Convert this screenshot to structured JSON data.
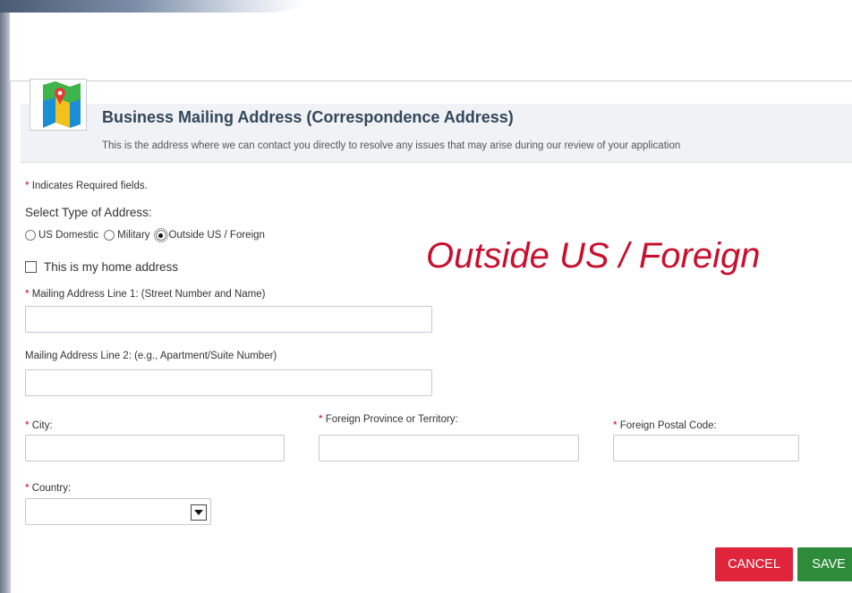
{
  "header": {
    "title": "Business Mailing Address (Correspondence Address)",
    "subtitle": "This is the address where we can contact you directly to resolve any issues that may arise during our review of your application",
    "icon": "map-icon"
  },
  "form": {
    "required_star": "*",
    "required_note": "Indicates Required fields.",
    "select_type_label": "Select Type of Address:",
    "address_types": [
      {
        "label": "US Domestic",
        "selected": false
      },
      {
        "label": "Military",
        "selected": false
      },
      {
        "label": "Outside US / Foreign",
        "selected": true
      }
    ],
    "home_address_label": "This is my home address",
    "home_address_checked": false,
    "mailing_line1_label": "Mailing Address Line 1: (Street Number and Name)",
    "mailing_line1_value": "",
    "mailing_line2_label": "Mailing Address Line 2: (e.g., Apartment/Suite Number)",
    "mailing_line2_value": "",
    "city_label": "City:",
    "city_value": "",
    "province_label": "Foreign Province or Territory:",
    "province_value": "",
    "postal_label": "Foreign Postal Code:",
    "postal_value": "",
    "country_label": "Country:",
    "country_value": ""
  },
  "annotation": {
    "text": "Outside US / Foreign",
    "color": "#c8102e"
  },
  "buttons": {
    "cancel": "CANCEL",
    "save": "SAVE"
  },
  "colors": {
    "cancel_bg": "#e0243a",
    "save_bg": "#2e8b3a",
    "title_color": "#33475b"
  }
}
